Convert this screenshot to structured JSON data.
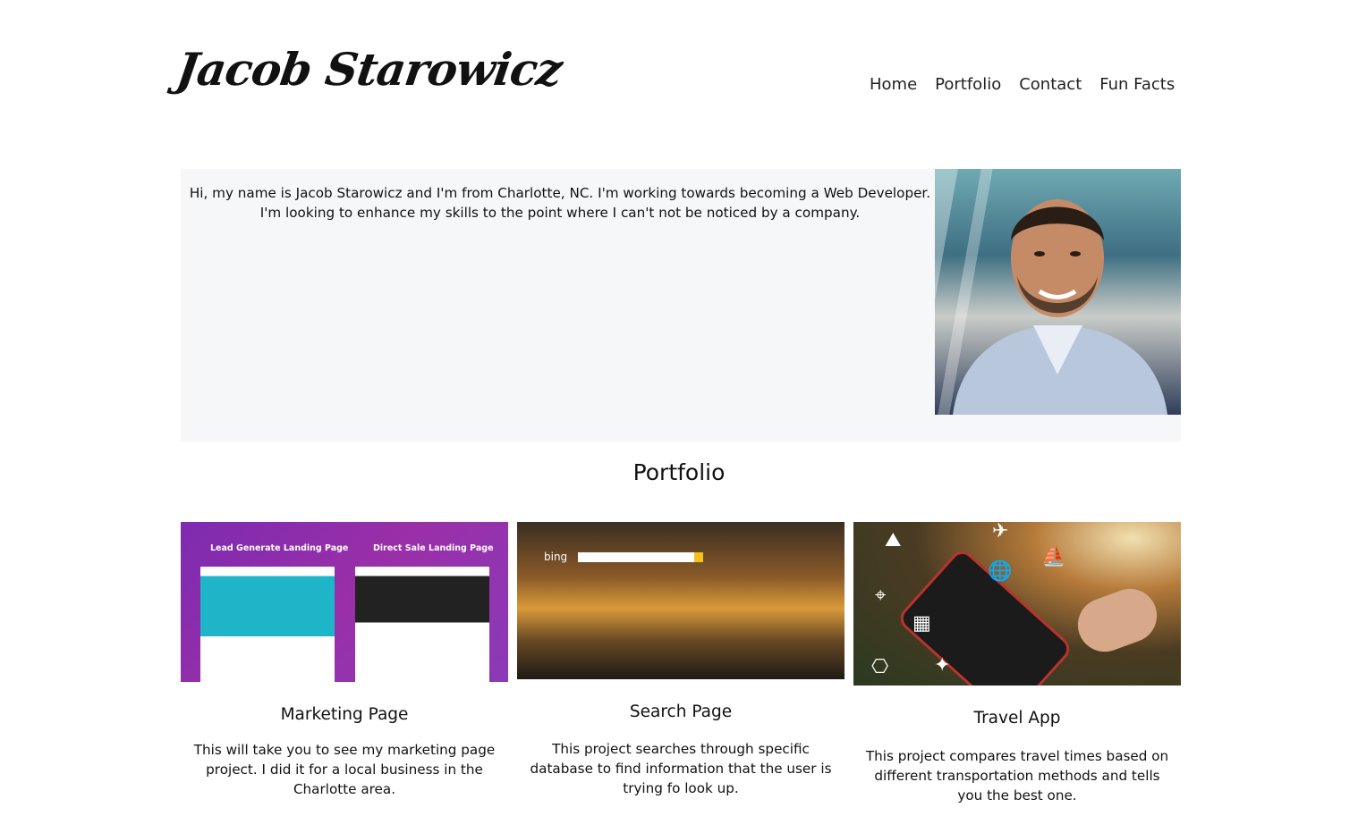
{
  "header": {
    "logo_text": "Jacob Starowicz",
    "nav": [
      "Home",
      "Portfolio",
      "Contact",
      "Fun Facts"
    ]
  },
  "about": {
    "text": "Hi, my name is Jacob Starowicz and I'm from Charlotte, NC. I'm working towards becoming a Web Developer. I'm looking to enhance my skills to the point where I can't not be noticed by a company."
  },
  "portfolio": {
    "title": "Portfolio",
    "cards": [
      {
        "title": "Marketing Page",
        "description": "This will take you to see my marketing page project. I did it for a local business in the Charlotte area.",
        "thumb_labels": [
          "Lead Generate Landing Page",
          "Direct Sale Landing Page"
        ]
      },
      {
        "title": "Search Page",
        "description": "This project searches through specific database to find information that the user is trying fo look up.",
        "thumb_labels": [
          "bing"
        ]
      },
      {
        "title": "Travel App",
        "description": "This project compares travel times based on different transportation methods and tells you the best one."
      }
    ]
  }
}
